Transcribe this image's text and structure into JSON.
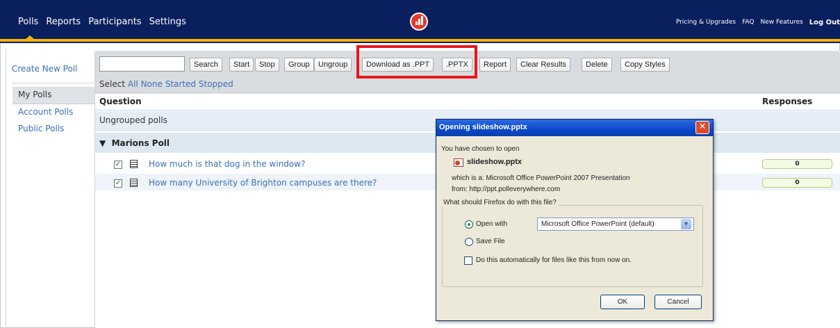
{
  "nav": {
    "left_links": [
      "Polls",
      "Reports",
      "Participants",
      "Settings"
    ],
    "right_links": [
      "Pricing & Upgrades",
      "FAQ",
      "New Features",
      "Log Out"
    ]
  },
  "sidebar": {
    "create_poll": "Create New Poll",
    "items": [
      {
        "label": "My Polls",
        "selected": true
      },
      {
        "label": "Account Polls"
      },
      {
        "label": "Public Polls"
      }
    ]
  },
  "toolbar": {
    "search_value": "",
    "buttons": [
      "Search",
      "Start",
      "Stop",
      "Group",
      "Ungroup",
      "Download as .PPT",
      ".PPTX",
      "Report",
      "Clear Results",
      "Delete",
      "Copy Styles"
    ],
    "select_label": "Select",
    "select_links": [
      "All",
      "None",
      "Started",
      "Stopped"
    ]
  },
  "table": {
    "col_question": "Question",
    "col_responses": "Responses",
    "group_ungrouped": "Ungrouped polls",
    "group_marion": "Marions Poll",
    "group_marion_arrow": "▼",
    "polls": [
      {
        "text": "How much is that dog in the window?",
        "responses": "0",
        "checked": true
      },
      {
        "text": "How many University of Brighton campuses are there?",
        "responses": "0",
        "checked": true
      }
    ]
  },
  "dialog": {
    "title": "Opening slideshow.pptx",
    "close": "✕",
    "chosen": "You have chosen to open",
    "filename": "slideshow.pptx",
    "which_is": "which is a:  Microsoft Office PowerPoint 2007 Presentation",
    "from": "from:  http://ppt.polleverywhere.com",
    "question": "What should Firefox do with this file?",
    "open_with_label": "Open with",
    "open_with_value": "Microsoft Office PowerPoint (default)",
    "save_file_label": "Save File",
    "auto_label": "Do this automatically for files like this from now on.",
    "ok": "OK",
    "cancel": "Cancel",
    "selected_option": "open_with"
  },
  "colors": {
    "nav_bg": "#0a1f5e",
    "nav_accent": "#f3b30c",
    "link": "#3a6eb8",
    "highlight": "#e8181e",
    "dialog_title": "#0a48c9"
  }
}
